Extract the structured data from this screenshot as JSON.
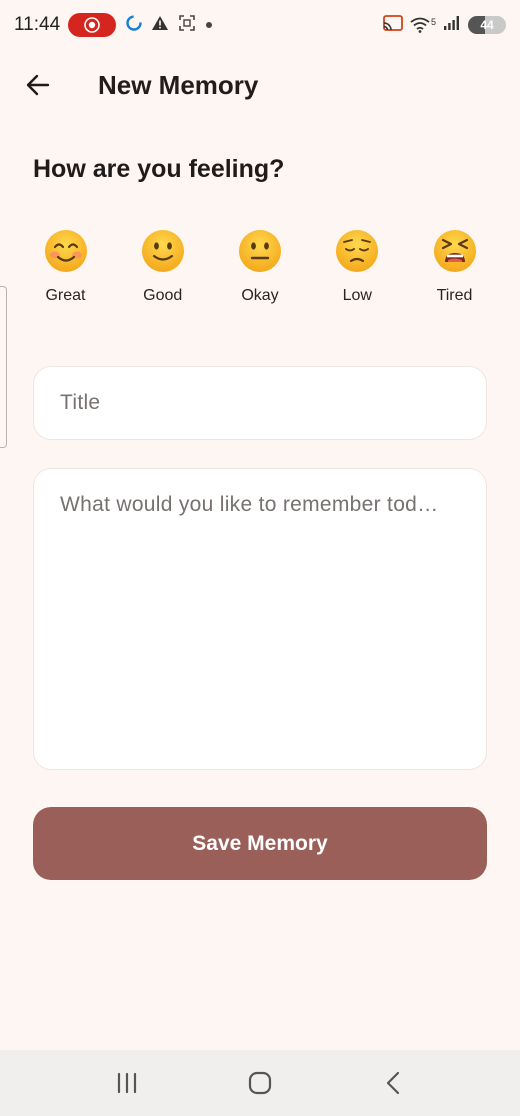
{
  "status_bar": {
    "time": "11:44",
    "battery": "44",
    "battery_level": 0.44,
    "signal_superscript": "5",
    "icons": [
      "screen-record-icon",
      "sync-icon",
      "warning-icon",
      "screenshot-icon",
      "dot-icon",
      "cast-icon",
      "wifi-icon",
      "signal-icon",
      "battery-icon"
    ]
  },
  "app_bar": {
    "title": "New Memory",
    "back_icon": "arrow-left-icon"
  },
  "mood_section": {
    "title": "How are you feeling?",
    "moods": [
      {
        "label": "Great",
        "emoji": "smiling-face-icon"
      },
      {
        "label": "Good",
        "emoji": "slight-smile-icon"
      },
      {
        "label": "Okay",
        "emoji": "neutral-face-icon"
      },
      {
        "label": "Low",
        "emoji": "pensive-face-icon"
      },
      {
        "label": "Tired",
        "emoji": "tired-face-icon"
      }
    ]
  },
  "form": {
    "title_placeholder": "Title",
    "title_value": "",
    "body_placeholder": "What would you like to remember tod…",
    "body_value": ""
  },
  "save_button": {
    "label": "Save Memory"
  },
  "colors": {
    "background": "#fdf6f3",
    "accent": "#9a5f58",
    "record": "#d4261e"
  },
  "nav_bar": {
    "icons": [
      "recents-icon",
      "home-icon",
      "back-icon"
    ]
  }
}
